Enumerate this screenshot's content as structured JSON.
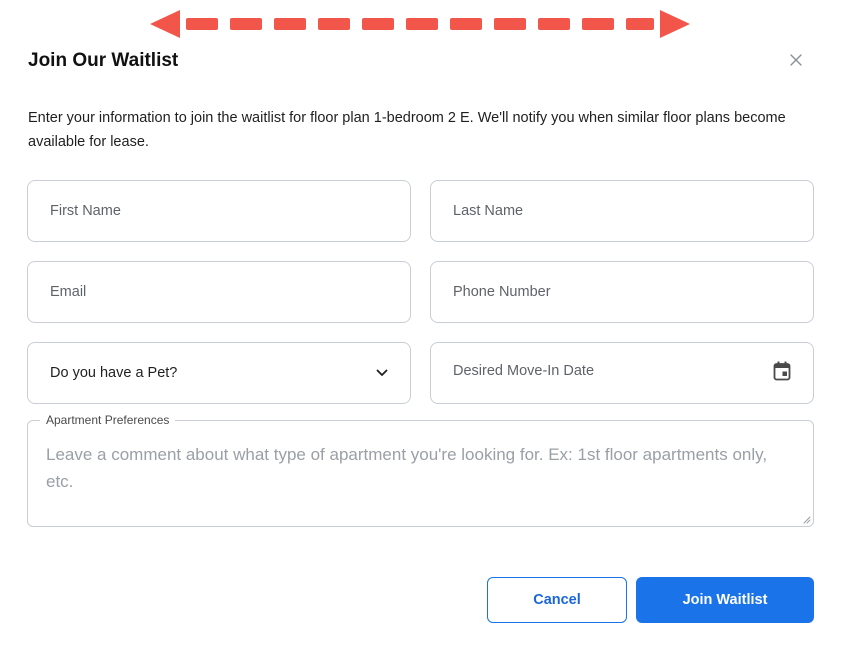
{
  "dialog": {
    "title": "Join Our Waitlist",
    "description": "Enter your information to join the waitlist for floor plan 1-bedroom 2 E. We'll notify you when similar floor plans become available for lease."
  },
  "form": {
    "first_name_placeholder": "First Name",
    "last_name_placeholder": "Last Name",
    "email_placeholder": "Email",
    "phone_placeholder": "Phone Number",
    "pet_select_value": "Do you have a Pet?",
    "move_in_placeholder": "Desired Move-In Date",
    "preferences_label": "Apartment Preferences",
    "preferences_placeholder": "Leave a comment about what type of apartment you're looking for. Ex: 1st floor apartments only, etc."
  },
  "actions": {
    "cancel_label": "Cancel",
    "join_label": "Join Waitlist"
  },
  "icons": {
    "close": "close-icon",
    "chevron": "chevron-down-icon",
    "calendar": "calendar-icon",
    "annotation_arrow": "double-headed-dashed-arrow"
  },
  "colors": {
    "accent": "#1a73e8",
    "annotation": "#f2564a",
    "border": "#c9ced6",
    "placeholder": "#9aa0a6"
  }
}
